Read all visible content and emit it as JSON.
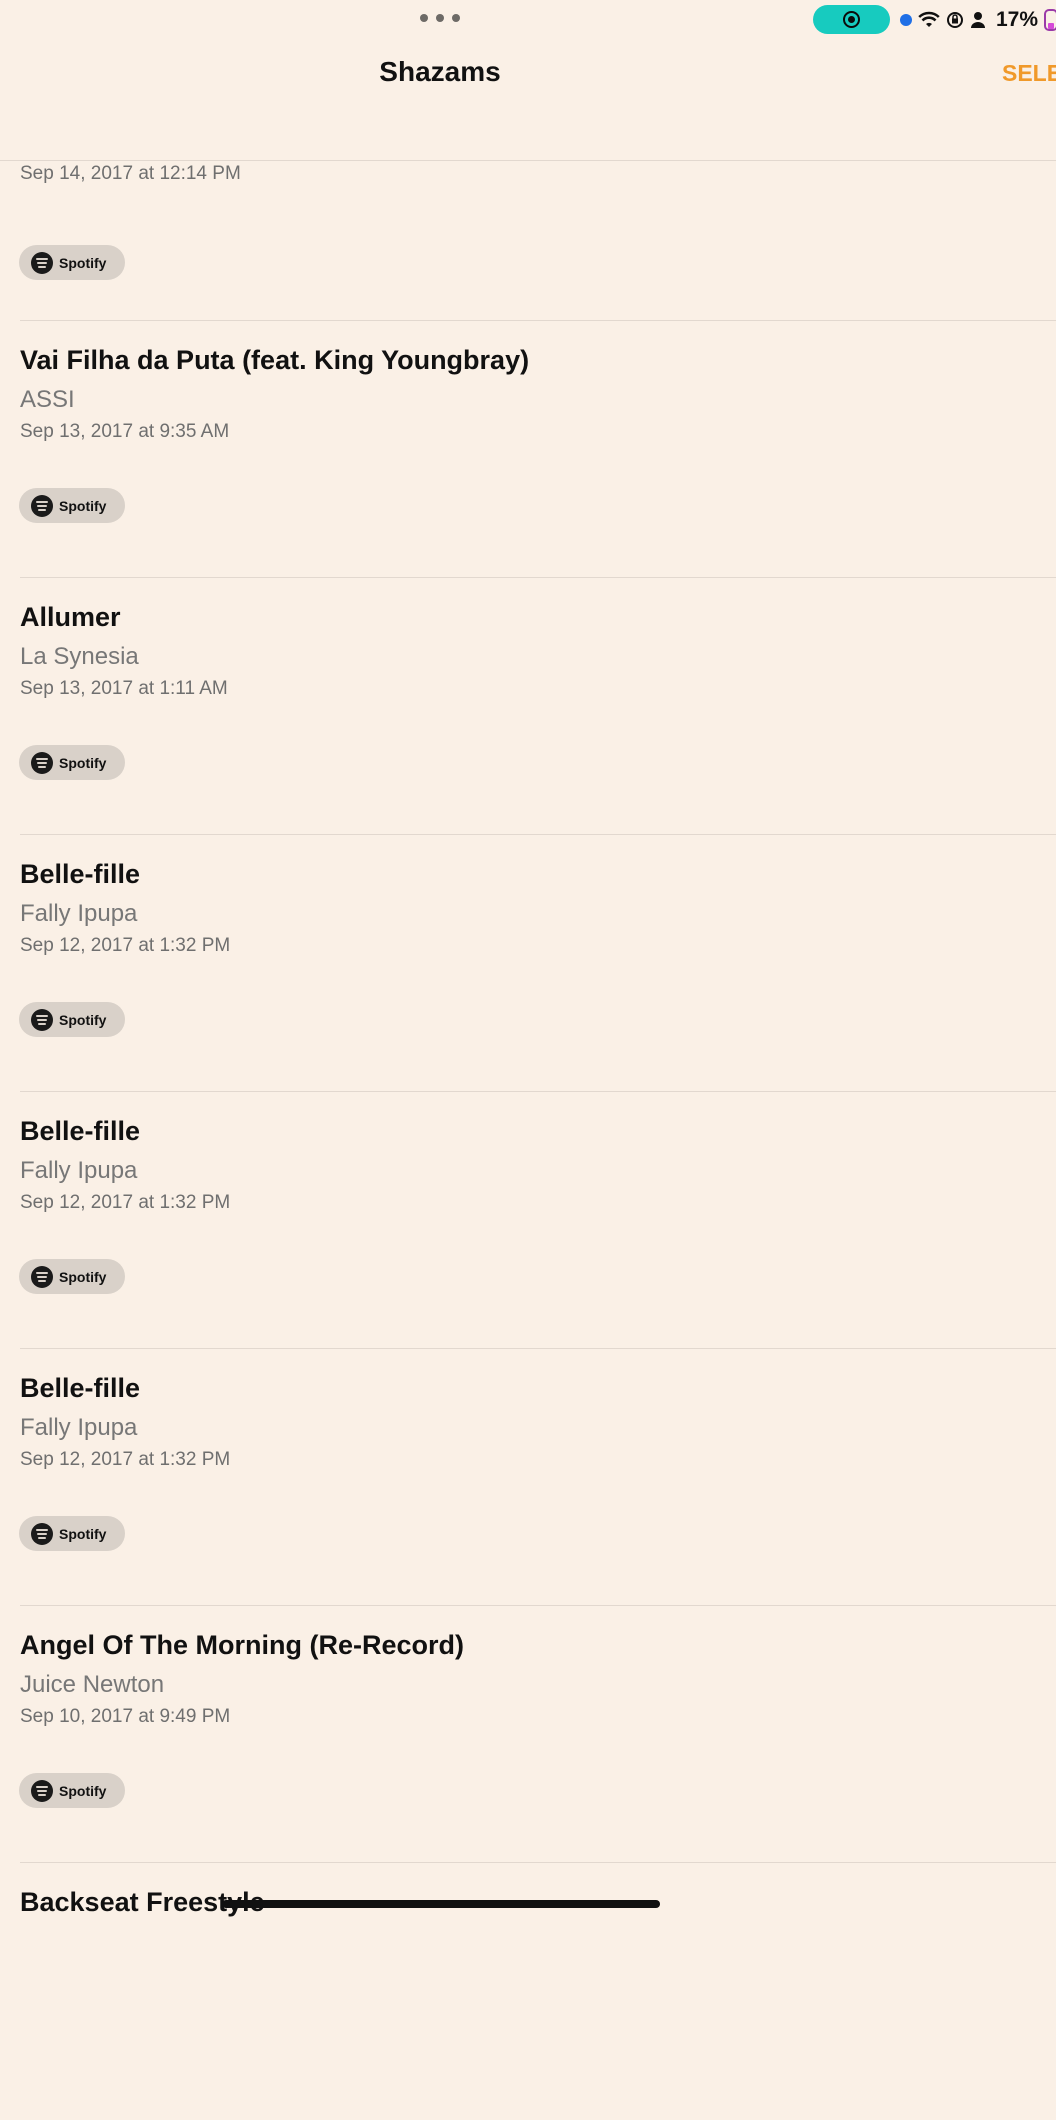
{
  "status_bar": {
    "battery_percent": "17%",
    "colors": {
      "record_pill": "#17cbbf",
      "location_dot": "#1f6fe6",
      "battery": "#d54ad8"
    },
    "icons": [
      "more-dots-icon",
      "screen-record-icon",
      "location-dot-icon",
      "wifi-icon",
      "rotation-lock-icon",
      "person-icon",
      "battery-icon"
    ]
  },
  "nav": {
    "title": "Shazams",
    "select_label": "SELE",
    "accent_color": "#f0992a"
  },
  "items": [
    {
      "title": "",
      "artist": "",
      "date": "Sep 14, 2017 at 12:14 PM",
      "service": "Spotify"
    },
    {
      "title": "Vai Filha da Puta (feat. King Youngbray)",
      "artist": "ASSI",
      "date": "Sep 13, 2017 at 9:35 AM",
      "service": "Spotify"
    },
    {
      "title": "Allumer",
      "artist": "La Synesia",
      "date": "Sep 13, 2017 at 1:11 AM",
      "service": "Spotify"
    },
    {
      "title": "Belle-fille",
      "artist": "Fally Ipupa",
      "date": "Sep 12, 2017 at 1:32 PM",
      "service": "Spotify"
    },
    {
      "title": "Belle-fille",
      "artist": "Fally Ipupa",
      "date": "Sep 12, 2017 at 1:32 PM",
      "service": "Spotify"
    },
    {
      "title": "Belle-fille",
      "artist": "Fally Ipupa",
      "date": "Sep 12, 2017 at 1:32 PM",
      "service": "Spotify"
    },
    {
      "title": "Angel Of The Morning (Re-Record)",
      "artist": "Juice Newton",
      "date": "Sep 10, 2017 at 9:49 PM",
      "service": "Spotify"
    },
    {
      "title": "Backseat Freestyle",
      "artist": "",
      "date": "",
      "service": ""
    }
  ]
}
